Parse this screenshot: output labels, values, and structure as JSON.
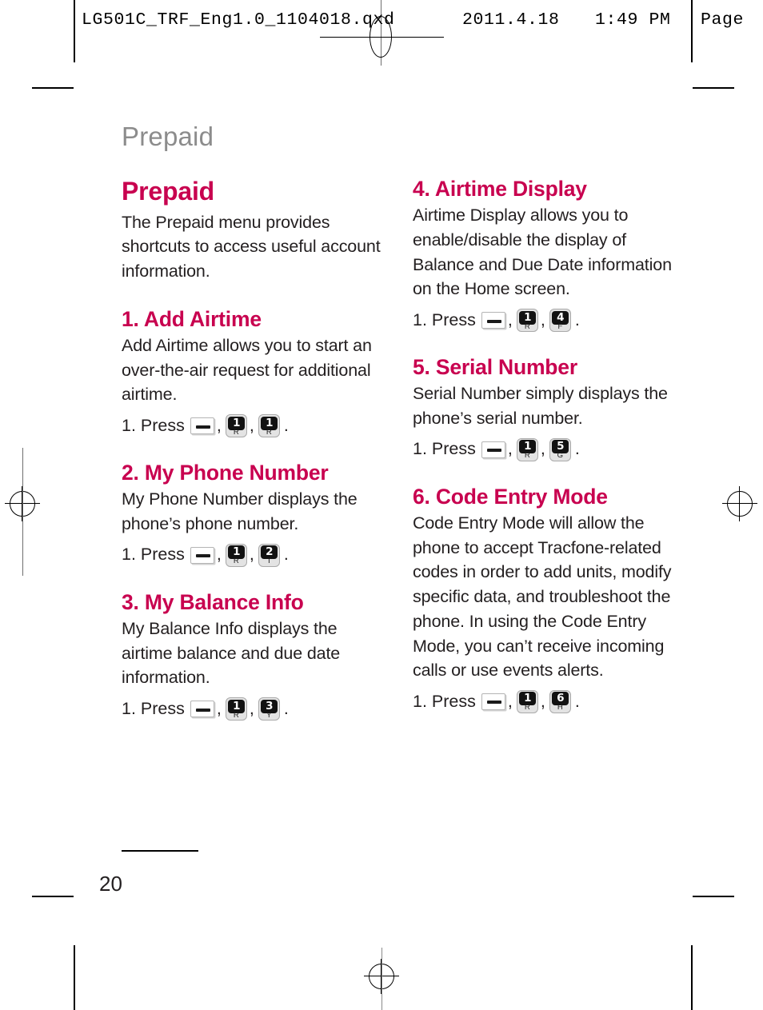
{
  "print_header": {
    "filename": "LG501C_TRF_Eng1.0_1104018.qxd",
    "date": "2011.4.18",
    "time": "1:49 PM",
    "page_label": "Page"
  },
  "running_head": "Prepaid",
  "page_number": "20",
  "accent_color": "#c8004f",
  "running_head_color": "#8c8c8c",
  "keys": {
    "menu": {
      "name": "menu-key",
      "glyph": "dash"
    },
    "k1": {
      "digit": "1",
      "letter": "R"
    },
    "k2": {
      "digit": "2",
      "letter": "T"
    },
    "k3": {
      "digit": "3",
      "letter": "Y"
    },
    "k4": {
      "digit": "4",
      "letter": "F"
    },
    "k5": {
      "digit": "5",
      "letter": "G"
    },
    "k6": {
      "digit": "6",
      "letter": "H"
    }
  },
  "press_label": "1. Press",
  "comma": ",",
  "period": ".",
  "left_column": {
    "title": "Prepaid",
    "intro": "The Prepaid menu provides shortcuts to access useful account information.",
    "sections": [
      {
        "heading": "1. Add Airtime",
        "body": "Add Airtime allows you to start an over-the-air request for additional airtime."
      },
      {
        "heading": "2. My Phone Number",
        "body": "My Phone Number displays the phone’s phone number."
      },
      {
        "heading": "3. My Balance Info",
        "body": "My Balance Info displays the airtime balance and due date information."
      }
    ]
  },
  "right_column": {
    "sections": [
      {
        "heading": "4. Airtime Display",
        "body": "Airtime Display allows you to enable/disable the display of Balance and Due Date information on the Home screen."
      },
      {
        "heading": "5. Serial Number",
        "body": "Serial Number simply displays the phone’s serial number."
      },
      {
        "heading": "6. Code Entry Mode",
        "body": "Code Entry Mode will allow the phone to accept Tracfone-related codes in order to add units, modify specific data, and troubleshoot the phone. In using the Code Entry Mode, you can’t receive incoming calls or use events alerts."
      }
    ]
  }
}
